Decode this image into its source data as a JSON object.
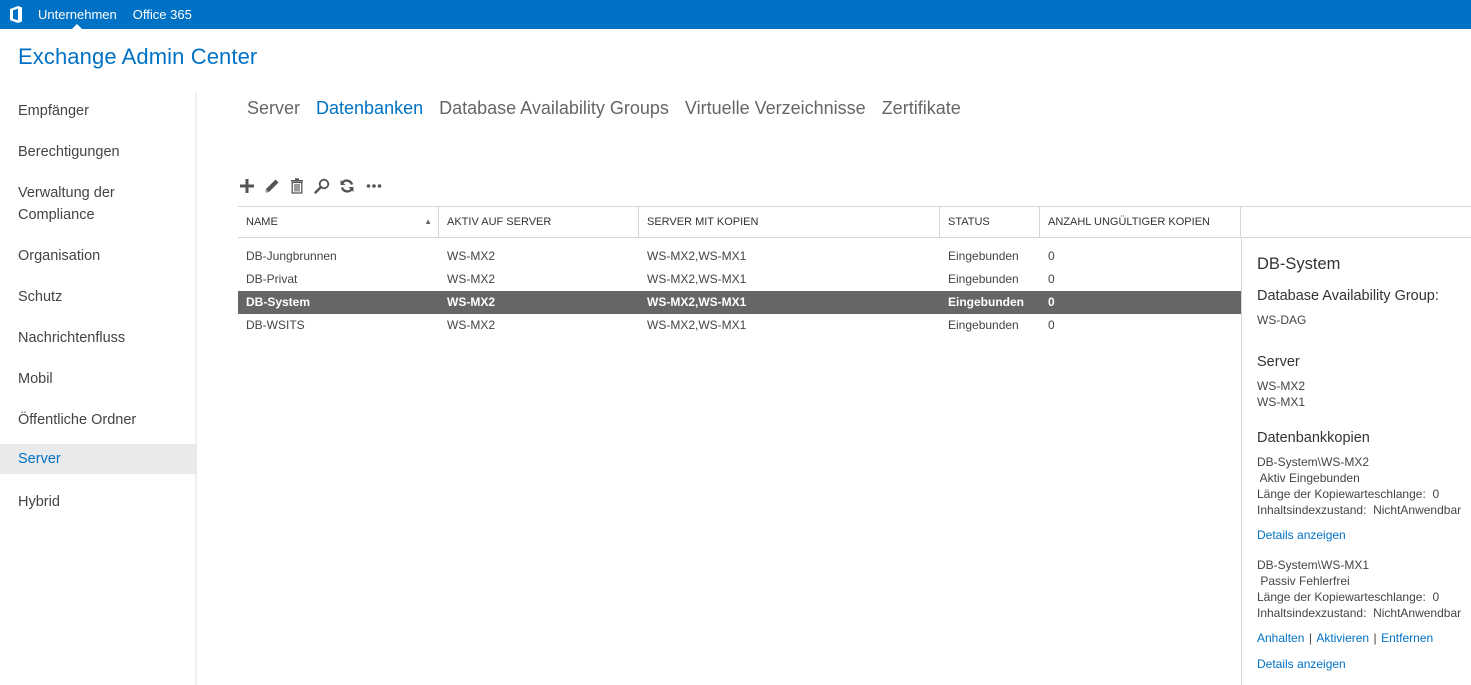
{
  "topbar": {
    "logo_icon": "office-logo-icon",
    "nav": [
      {
        "label": "Unternehmen",
        "active": true
      },
      {
        "label": "Office 365",
        "active": false
      }
    ],
    "color": "#0072c6"
  },
  "app_title": "Exchange Admin Center",
  "sidebar": {
    "items": [
      {
        "label": "Empfänger"
      },
      {
        "label": "Berechtigungen"
      },
      {
        "label": "Verwaltung der Compliance"
      },
      {
        "label": "Organisation"
      },
      {
        "label": "Schutz"
      },
      {
        "label": "Nachrichtenfluss"
      },
      {
        "label": "Mobil"
      },
      {
        "label": "Öffentliche Ordner"
      },
      {
        "label": "Server",
        "active": true
      },
      {
        "label": "Hybrid"
      }
    ]
  },
  "tabs": [
    {
      "label": "Server"
    },
    {
      "label": "Datenbanken",
      "active": true
    },
    {
      "label": "Database Availability Groups"
    },
    {
      "label": "Virtuelle Verzeichnisse"
    },
    {
      "label": "Zertifikate"
    }
  ],
  "toolbar": {
    "buttons": [
      {
        "name": "add",
        "icon": "plus-icon"
      },
      {
        "name": "edit",
        "icon": "pencil-icon"
      },
      {
        "name": "delete",
        "icon": "trash-icon"
      },
      {
        "name": "search",
        "icon": "search-icon"
      },
      {
        "name": "refresh",
        "icon": "refresh-icon"
      },
      {
        "name": "more",
        "icon": "ellipsis-icon"
      }
    ]
  },
  "grid": {
    "columns": [
      {
        "label": "NAME",
        "sorted": "ascending"
      },
      {
        "label": "AKTIV AUF SERVER"
      },
      {
        "label": "SERVER MIT KOPIEN"
      },
      {
        "label": "STATUS"
      },
      {
        "label": "ANZAHL UNGÜLTIGER KOPIEN"
      }
    ],
    "rows": [
      {
        "name": "DB-Jungbrunnen",
        "active_server": "WS-MX2",
        "copies": "WS-MX2,WS-MX1",
        "status": "Eingebunden",
        "invalid": "0"
      },
      {
        "name": "DB-Privat",
        "active_server": "WS-MX2",
        "copies": "WS-MX2,WS-MX1",
        "status": "Eingebunden",
        "invalid": "0"
      },
      {
        "name": "DB-System",
        "active_server": "WS-MX2",
        "copies": "WS-MX2,WS-MX1",
        "status": "Eingebunden",
        "invalid": "0",
        "selected": true
      },
      {
        "name": "DB-WSITS",
        "active_server": "WS-MX2",
        "copies": "WS-MX2,WS-MX1",
        "status": "Eingebunden",
        "invalid": "0"
      }
    ]
  },
  "details": {
    "title": "DB-System",
    "dag_label": "Database Availability Group:",
    "dag_value": "WS-DAG",
    "server_label": "Server",
    "servers": [
      "WS-MX2",
      "WS-MX1"
    ],
    "copies_label": "Datenbankkopien",
    "copies": [
      {
        "name": "DB-System\\WS-MX2",
        "state": " Aktiv Eingebunden",
        "queue": "Länge der Kopiewarteschlange:  0",
        "index": "Inhaltsindexzustand:  NichtAnwendbar",
        "actions": [],
        "details_link": "Details anzeigen"
      },
      {
        "name": "DB-System\\WS-MX1",
        "state": " Passiv Fehlerfrei",
        "queue": "Länge der Kopiewarteschlange:  0",
        "index": "Inhaltsindexzustand:  NichtAnwendbar",
        "actions": [
          "Anhalten",
          "Aktivieren",
          "Entfernen"
        ],
        "action_separator": "|",
        "details_link": "Details anzeigen"
      }
    ]
  }
}
